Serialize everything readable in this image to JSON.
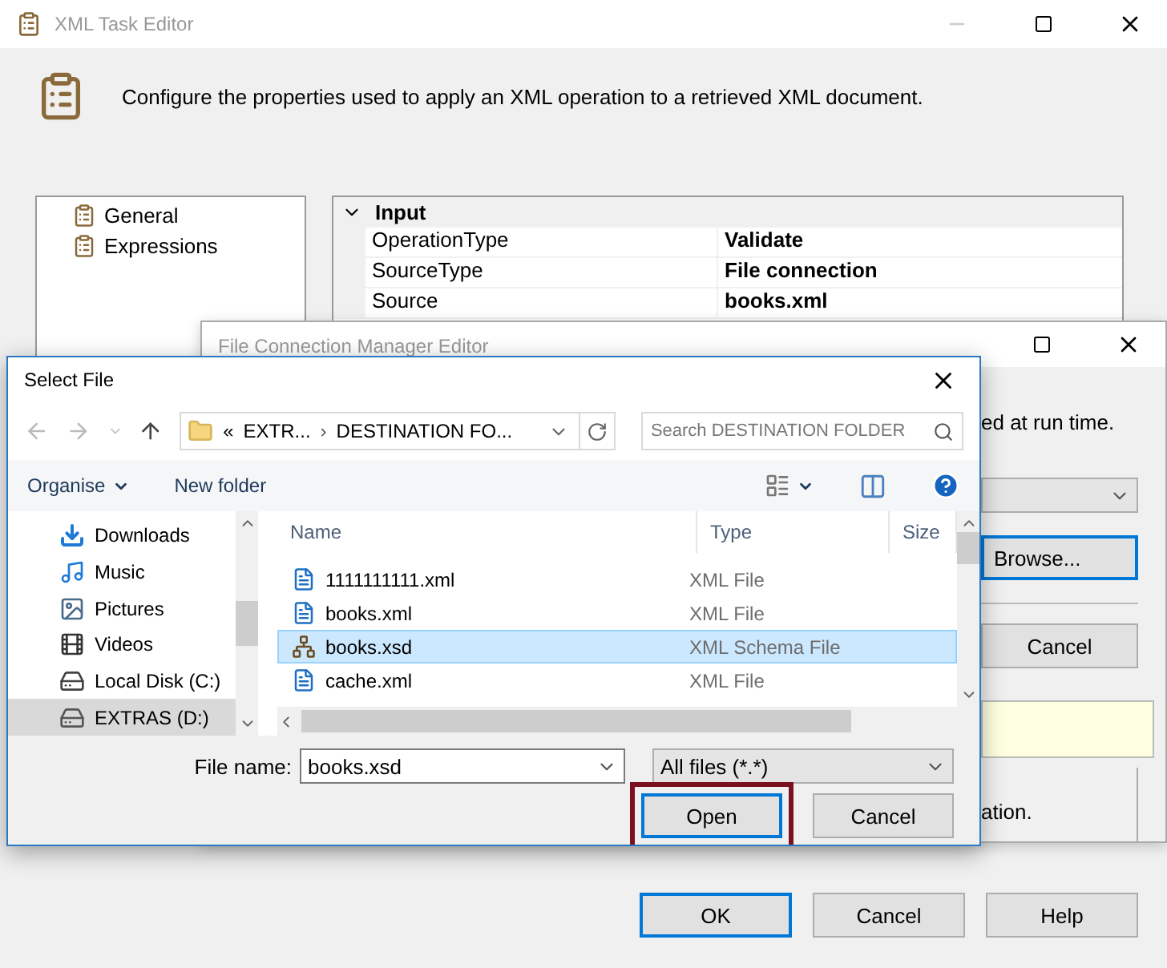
{
  "main_window": {
    "title": "XML Task Editor",
    "description": "Configure the properties used to apply an XML operation to a retrieved XML document.",
    "pages": [
      "General",
      "Expressions"
    ],
    "properties": {
      "category": "Input",
      "expanded": true,
      "rows": [
        {
          "name": "OperationType",
          "value": "Validate"
        },
        {
          "name": "SourceType",
          "value": "File connection"
        },
        {
          "name": "Source",
          "value": "books.xml"
        }
      ]
    },
    "buttons": [
      {
        "label": "OK",
        "default": true
      },
      {
        "label": "Cancel",
        "default": false
      },
      {
        "label": "Help",
        "default": false
      }
    ]
  },
  "connection_window": {
    "title": "File Connection Manager Editor",
    "hint_fragment": "ed at run time.",
    "browse_button": "Browse...",
    "cancel_button": "Cancel",
    "note_fragment": "ation."
  },
  "select_file": {
    "title": "Select File",
    "path_overflow": "«",
    "path_separator": "›",
    "path": [
      "EXTR...",
      "DESTINATION FO..."
    ],
    "search": {
      "placeholder": "Search DESTINATION FOLDER"
    },
    "toolbar": {
      "organise": "Organise",
      "new_folder": "New folder"
    },
    "nav_items": [
      {
        "label": "Downloads",
        "kind": "downloads",
        "selected": false
      },
      {
        "label": "Music",
        "kind": "music",
        "selected": false
      },
      {
        "label": "Pictures",
        "kind": "pictures",
        "selected": false
      },
      {
        "label": "Videos",
        "kind": "videos",
        "selected": false
      },
      {
        "label": "Local Disk (C:)",
        "kind": "disk",
        "selected": false
      },
      {
        "label": "EXTRAS (D:)",
        "kind": "drive",
        "selected": true
      }
    ],
    "columns": [
      "Name",
      "Type",
      "Size"
    ],
    "files": [
      {
        "name": "1111111111.xml",
        "type": "XML File",
        "kind": "xml",
        "selected": false
      },
      {
        "name": "books.xml",
        "type": "XML File",
        "kind": "xml",
        "selected": false
      },
      {
        "name": "books.xsd",
        "type": "XML Schema File",
        "kind": "schema",
        "selected": true
      },
      {
        "name": "cache.xml",
        "type": "XML File",
        "kind": "xml",
        "selected": false
      }
    ],
    "file_name_label": "File name:",
    "file_name": "books.xsd",
    "filter": "All files (*.*)",
    "buttons": [
      {
        "label": "Open",
        "default": true,
        "highlighted": true
      },
      {
        "label": "Cancel",
        "default": false,
        "highlighted": false
      }
    ]
  }
}
